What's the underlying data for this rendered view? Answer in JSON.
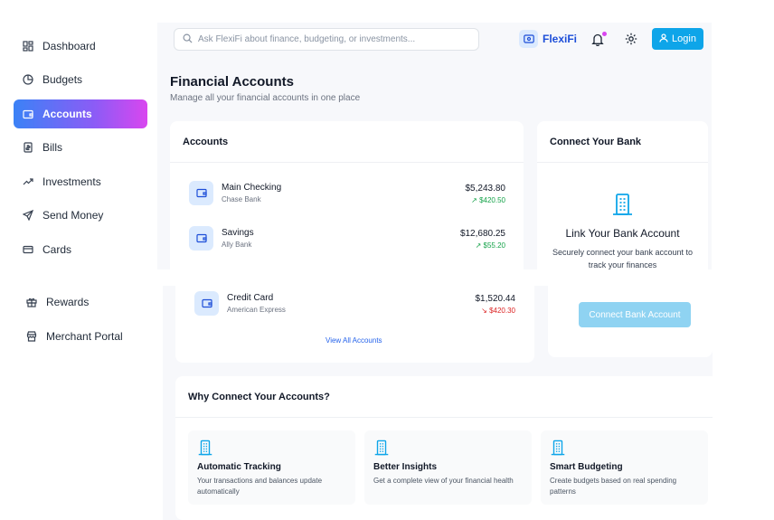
{
  "sidebar": {
    "items": [
      {
        "label": "Dashboard",
        "icon": "grid-icon"
      },
      {
        "label": "Budgets",
        "icon": "pie-chart-icon"
      },
      {
        "label": "Accounts",
        "icon": "wallet-icon",
        "active": true
      },
      {
        "label": "Bills",
        "icon": "receipt-icon"
      },
      {
        "label": "Investments",
        "icon": "trending-up-icon"
      },
      {
        "label": "Send Money",
        "icon": "send-icon"
      },
      {
        "label": "Cards",
        "icon": "credit-card-icon"
      },
      {
        "label": "Rewards",
        "icon": "gift-icon"
      },
      {
        "label": "Merchant Portal",
        "icon": "store-icon"
      }
    ]
  },
  "header": {
    "search_placeholder": "Ask FlexiFi about finance, budgeting, or investments...",
    "brand": "FlexiFi",
    "login_label": "Login"
  },
  "page": {
    "title": "Financial Accounts",
    "subtitle": "Manage all your financial accounts in one place"
  },
  "accounts_card": {
    "title": "Accounts",
    "accounts": [
      {
        "name": "Main Checking",
        "institution": "Chase Bank",
        "balance": "$5,243.80",
        "change": "$420.50",
        "trend": "up"
      },
      {
        "name": "Savings",
        "institution": "Ally Bank",
        "balance": "$12,680.25",
        "change": "$55.20",
        "trend": "up"
      },
      {
        "name": "Credit Card",
        "institution": "American Express",
        "balance": "$1,520.44",
        "change": "$420.30",
        "trend": "down"
      }
    ],
    "view_all": "View All Accounts"
  },
  "connect_card": {
    "title": "Connect Your Bank",
    "link_title": "Link Your Bank Account",
    "description": "Securely connect your bank account to track your finances",
    "button": "Connect Bank Account"
  },
  "why": {
    "title": "Why Connect Your Accounts?",
    "features": [
      {
        "title": "Automatic Tracking",
        "description": "Your transactions and balances update automatically"
      },
      {
        "title": "Better Insights",
        "description": "Get a complete view of your financial health"
      },
      {
        "title": "Smart Budgeting",
        "description": "Create budgets based on real spending patterns"
      }
    ]
  },
  "colors": {
    "accent": "#0ea5e9",
    "brand": "#1d4ed8",
    "positive": "#16a34a",
    "negative": "#dc2626",
    "active_gradient": [
      "#3b82f6",
      "#8b5cf6",
      "#d946ef"
    ]
  }
}
